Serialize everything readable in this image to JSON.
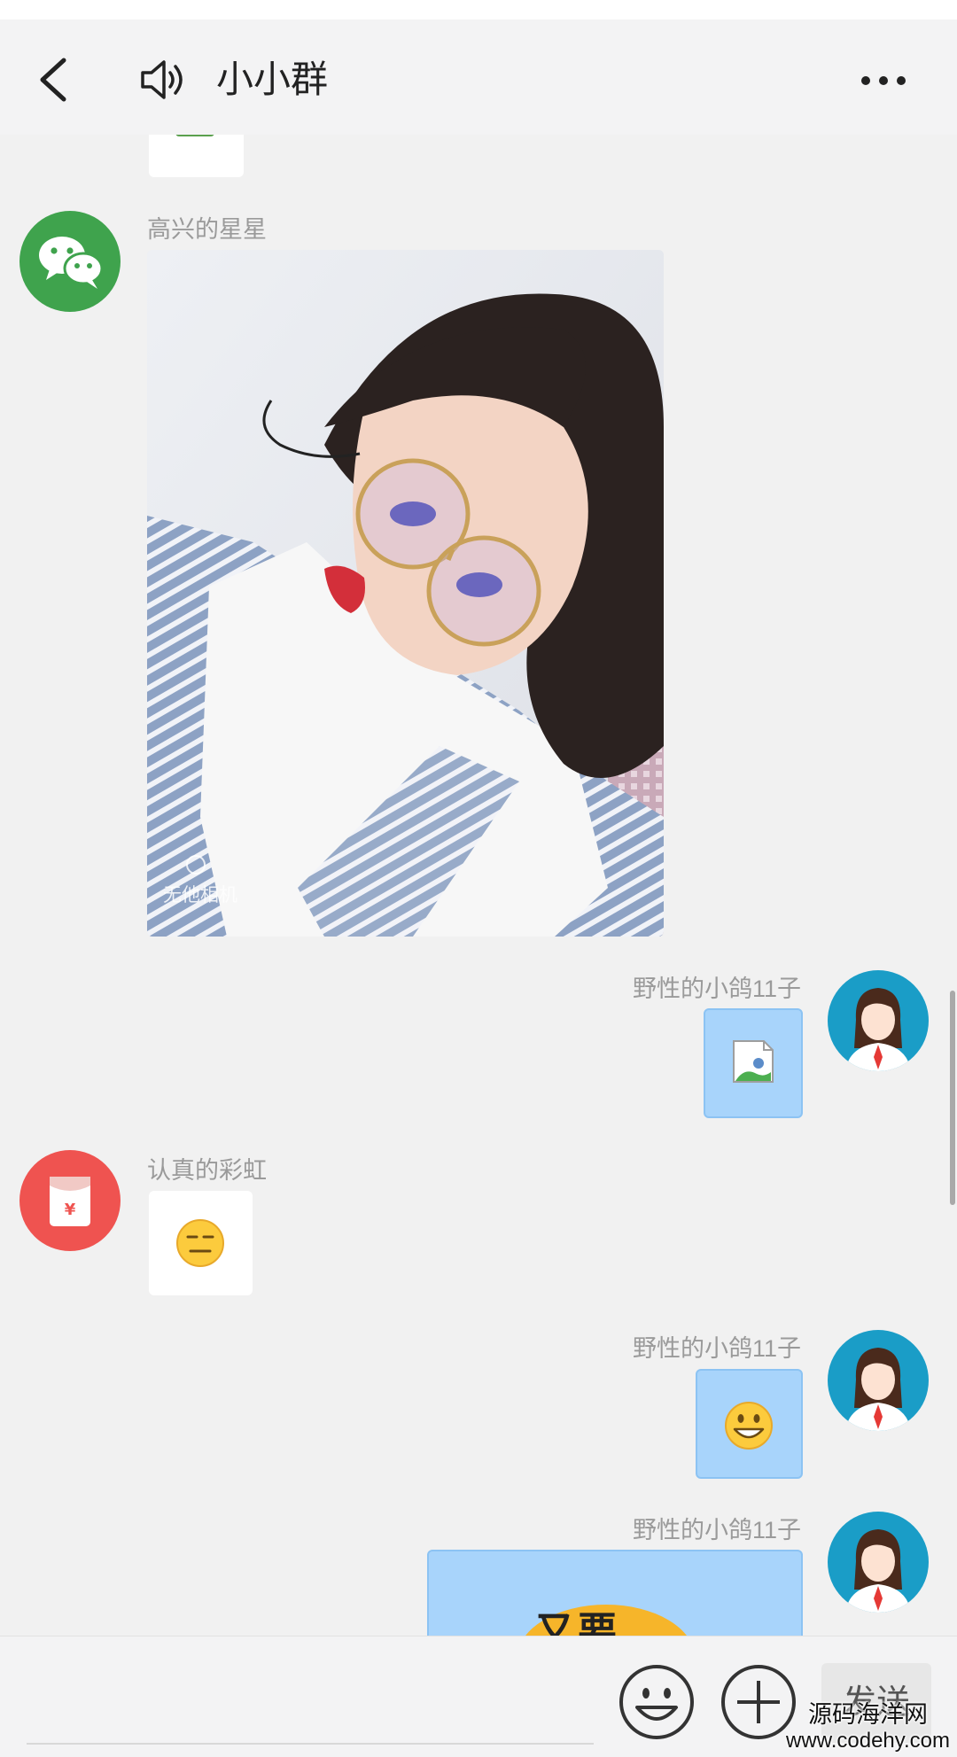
{
  "header": {
    "title": "小小群",
    "back_icon": "back-arrow-icon",
    "speaker_icon": "speaker-icon",
    "more_icon": "more-dots-icon"
  },
  "messages": [
    {
      "sender": "高兴的星星",
      "type": "image",
      "avatar": "wechat-logo",
      "watermark_text": "无他相机"
    },
    {
      "sender": "野性的小鸽11子",
      "type": "image-placeholder",
      "avatar": "girl-avatar"
    },
    {
      "sender": "认真的彩虹",
      "type": "emoji",
      "emoji": "😑",
      "avatar": "red-packet"
    },
    {
      "sender": "野性的小鸽11子",
      "type": "emoji",
      "emoji": "😀",
      "avatar": "girl-avatar"
    },
    {
      "sender": "野性的小鸽11子",
      "type": "sticker",
      "sticker_text": "又要",
      "avatar": "girl-avatar"
    }
  ],
  "input_bar": {
    "send_label": "发送",
    "emoji_icon": "emoji-icon",
    "plus_icon": "plus-icon"
  },
  "watermark": {
    "line1": "源码海洋网",
    "line2": "www.codehy.com"
  },
  "colors": {
    "background": "#f1f1f1",
    "outgoing_bubble": "#a8d4fb",
    "wechat_green": "#3fa34d",
    "red_packet": "#ef5350"
  }
}
